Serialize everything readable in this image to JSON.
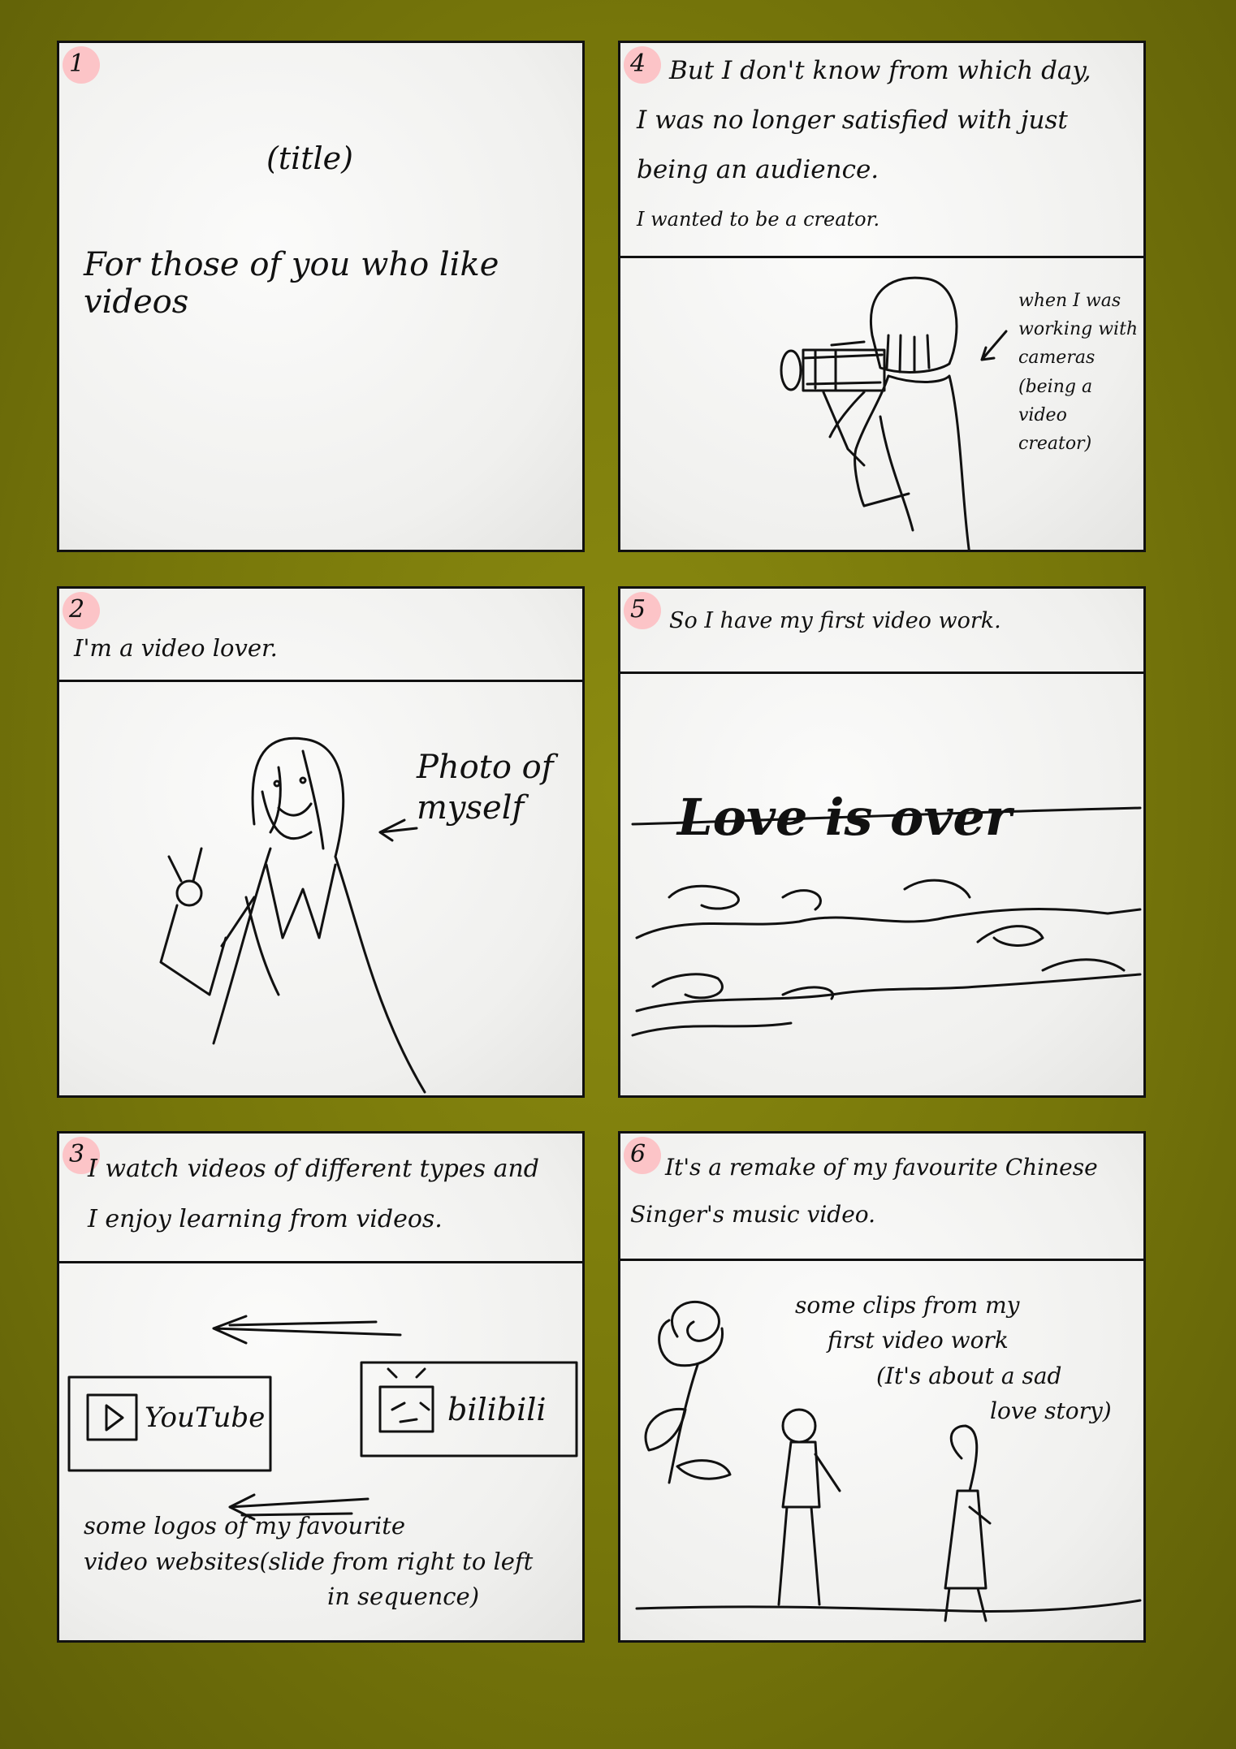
{
  "panels": {
    "p1": {
      "number": "1",
      "title": "(title)",
      "subtitle": "For those of you who like videos"
    },
    "p2": {
      "number": "2",
      "caption": "I'm a video lover.",
      "note": [
        "Photo of",
        "myself"
      ]
    },
    "p3": {
      "number": "3",
      "caption": [
        "I watch videos of different types and",
        "I enjoy learning from videos."
      ],
      "logo1": "YouTube",
      "logo2": "bilibili",
      "note": [
        "some logos of my favourite",
        "video websites(slide from right to left",
        "in sequence)"
      ]
    },
    "p4": {
      "number": "4",
      "caption": [
        "But I don't know from which day,",
        "I was no longer satisfied with just",
        "being an audience."
      ],
      "caption_small": "I wanted to be a creator.",
      "note": [
        "when I was",
        "working with",
        "cameras",
        "(being a video",
        "creator)"
      ]
    },
    "p5": {
      "number": "5",
      "caption": "So I have my first video work.",
      "art_title": "Love is over"
    },
    "p6": {
      "number": "6",
      "caption": [
        "It's a remake of my favourite Chinese",
        "Singer's music video."
      ],
      "note": [
        "some clips from my",
        "first video work",
        "(It's about a sad",
        "love story)"
      ]
    }
  }
}
